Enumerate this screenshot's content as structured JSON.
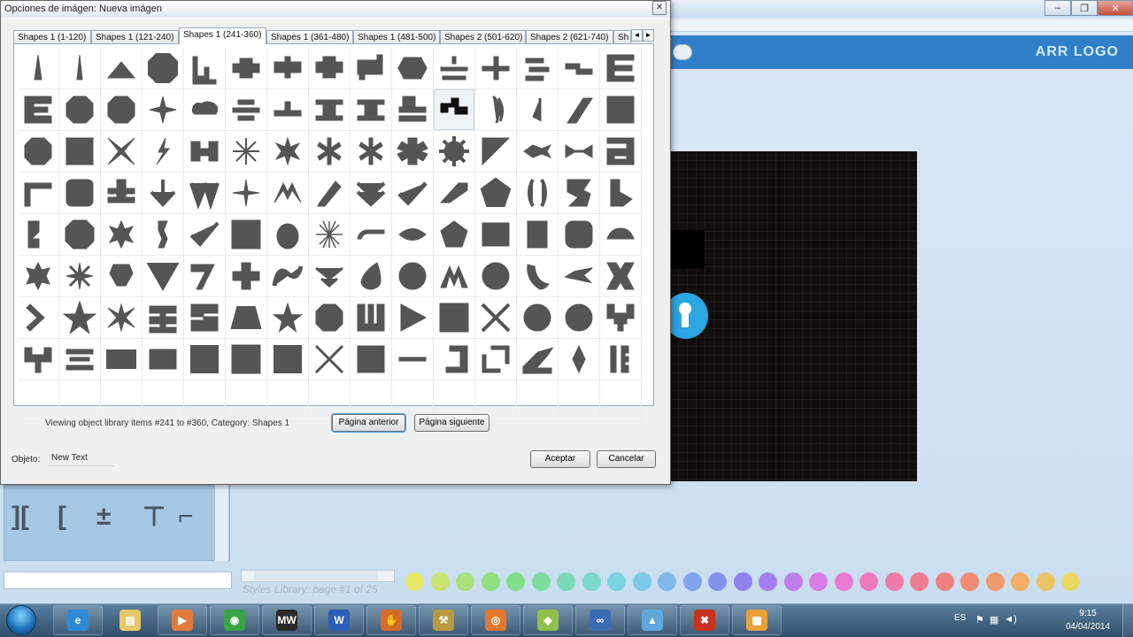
{
  "dialog": {
    "title": "Opciones de imágen: Nueva imágen",
    "close_label": "✕",
    "tabs": [
      {
        "label": "Shapes 1 (1-120)",
        "active": false
      },
      {
        "label": "Shapes 1 (121-240)",
        "active": false
      },
      {
        "label": "Shapes 1 (241-360)",
        "active": true
      },
      {
        "label": "Shapes 1 (361-480)",
        "active": false
      },
      {
        "label": "Shapes 1 (481-500)",
        "active": false
      },
      {
        "label": "Shapes 2 (501-620)",
        "active": false
      },
      {
        "label": "Shapes 2 (621-740)",
        "active": false
      },
      {
        "label": "Sh",
        "active": false
      }
    ],
    "tab_scroll_left": "◄",
    "tab_scroll_right": "►",
    "status_text": "Viewing object library items #241 to #360, Category: Shapes 1",
    "prev_button": "Página anterior",
    "next_button": "Página siguiente",
    "object_label": "Objeto:",
    "object_value": "New Text",
    "ok_button": "Aceptar",
    "cancel_button": "Cancelar",
    "grid": {
      "columns": 15,
      "rows_with_shapes": 8,
      "empty_rows": 1
    }
  },
  "background_app": {
    "logo_text": "ARR LOGO",
    "window_buttons": [
      "–",
      "❐",
      "✕"
    ],
    "styles_library_label": "Styles Library: page #1 of 25",
    "scroll_left": "◄",
    "scroll_right": "►",
    "color_swatches": [
      "#e6e86a",
      "#c9e46e",
      "#a9e27a",
      "#8fe07f",
      "#80de8b",
      "#7cdc9e",
      "#7adab6",
      "#79d8cc",
      "#78d4de",
      "#7ac9e6",
      "#7cb8ea",
      "#7fa5ec",
      "#8290ee",
      "#8e82ee",
      "#a47eee",
      "#c07eec",
      "#d97de6",
      "#ea7ad4",
      "#ef79bf",
      "#f07aa8",
      "#f07c92",
      "#f0807e",
      "#f08a72",
      "#f09a6c",
      "#f0ae68",
      "#ecc464",
      "#e8d864"
    ]
  },
  "taskbar": {
    "items": [
      {
        "name": "ie",
        "label": "e",
        "color": "#2d8ad9"
      },
      {
        "name": "explorer",
        "label": "▤",
        "color": "#e8c565"
      },
      {
        "name": "media-player",
        "label": "▶",
        "color": "#e27a3c"
      },
      {
        "name": "chrome",
        "label": "◉",
        "color": "#3aa548"
      },
      {
        "name": "mw",
        "label": "MW",
        "color": "#2a2a2a"
      },
      {
        "name": "word",
        "label": "W",
        "color": "#2b5fb8"
      },
      {
        "name": "app-hand",
        "label": "✋",
        "color": "#d76b2a"
      },
      {
        "name": "tools",
        "label": "⚒",
        "color": "#b79a3d"
      },
      {
        "name": "firefox",
        "label": "◎",
        "color": "#e6772e"
      },
      {
        "name": "folder-app",
        "label": "◆",
        "color": "#8fc04d"
      },
      {
        "name": "link-app",
        "label": "∞",
        "color": "#3b6db5"
      },
      {
        "name": "logo-app",
        "label": "▲",
        "color": "#5fa8de"
      },
      {
        "name": "x-app",
        "label": "✖",
        "color": "#c8321e"
      },
      {
        "name": "paint-app",
        "label": "▦",
        "color": "#e8a23a"
      }
    ],
    "language": "ES",
    "time": "9:15",
    "date": "04/04/2014"
  }
}
